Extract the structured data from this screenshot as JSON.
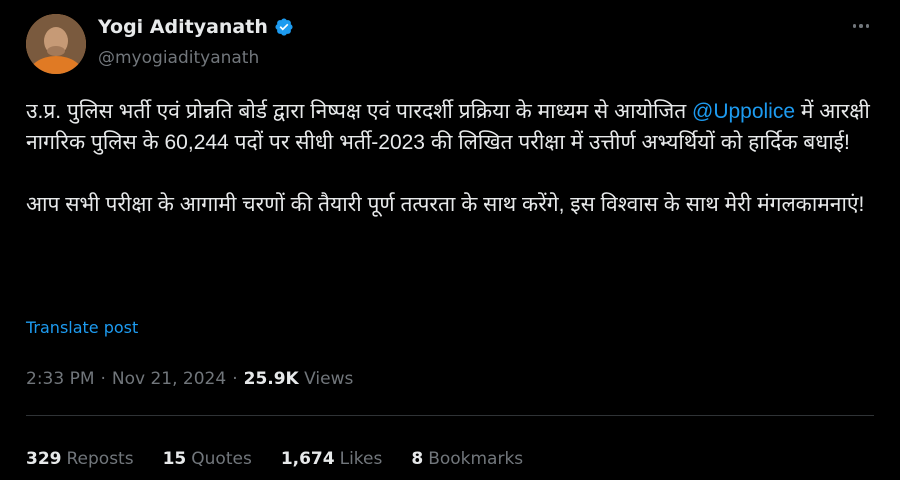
{
  "author": {
    "name": "Yogi Adityanath",
    "handle": "@myogiadityanath",
    "verified_color": "#1d9bf0"
  },
  "post": {
    "text_1_before": "उ.प्र. पुलिस भर्ती एवं प्रोन्नति बोर्ड द्वारा निष्पक्ष एवं पारदर्शी प्रक्रिया के माध्यम से आयोजित ",
    "mention": "@Uppolice",
    "text_1_after": " में आरक्षी नागरिक पुलिस के 60,244 पदों पर सीधी भर्ती-2023 की लिखित परीक्षा में उत्तीर्ण अभ्यर्थियों को हार्दिक बधाई!",
    "text_2": "आप सभी परीक्षा के आगामी चरणों की तैयारी पूर्ण तत्परता के साथ करेंगे, इस विश्वास के साथ मेरी मंगलकामनाएं!",
    "translate_label": "Translate post"
  },
  "meta": {
    "time": "2:33 PM",
    "separator": "·",
    "date": "Nov 21, 2024",
    "views_count": "25.9K",
    "views_label": "Views"
  },
  "stats": {
    "reposts_count": "329",
    "reposts_label": "Reposts",
    "quotes_count": "15",
    "quotes_label": "Quotes",
    "likes_count": "1,674",
    "likes_label": "Likes",
    "bookmarks_count": "8",
    "bookmarks_label": "Bookmarks"
  },
  "colors": {
    "background": "#000000",
    "text": "#e7e9ea",
    "secondary": "#71767b",
    "accent": "#1d9bf0"
  },
  "icons": {
    "avatar": "profile-photo",
    "verified": "verified-badge-icon",
    "more": "more-options-icon"
  }
}
